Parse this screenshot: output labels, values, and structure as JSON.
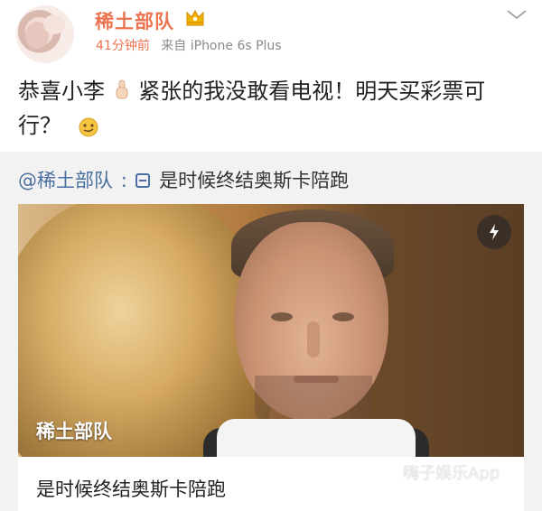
{
  "post": {
    "username": "稀土部队",
    "time": "41分钟前",
    "source": "来自 iPhone 6s Plus",
    "text_part1": "恭喜小李",
    "text_part2": "紧张的我没敢看电视！明天买彩票可行？"
  },
  "repost": {
    "mention": "@稀土部队",
    "separator": ":",
    "text": "是时候终结奥斯卡陪跑",
    "card": {
      "overlay_label": "稀土部队",
      "title": "是时候终结奥斯卡陪跑"
    }
  },
  "watermark": "嗨子娱乐App",
  "icons": {
    "crown": "crown-icon",
    "chevron": "chevron-down-icon",
    "hand": "hand-icon",
    "smiley": "smiley-icon",
    "link": "link-icon",
    "lightning": "lightning-icon"
  },
  "colors": {
    "username": "#eb7350",
    "mention": "#4a6fa0",
    "repost_bg": "#f2f2f2"
  }
}
